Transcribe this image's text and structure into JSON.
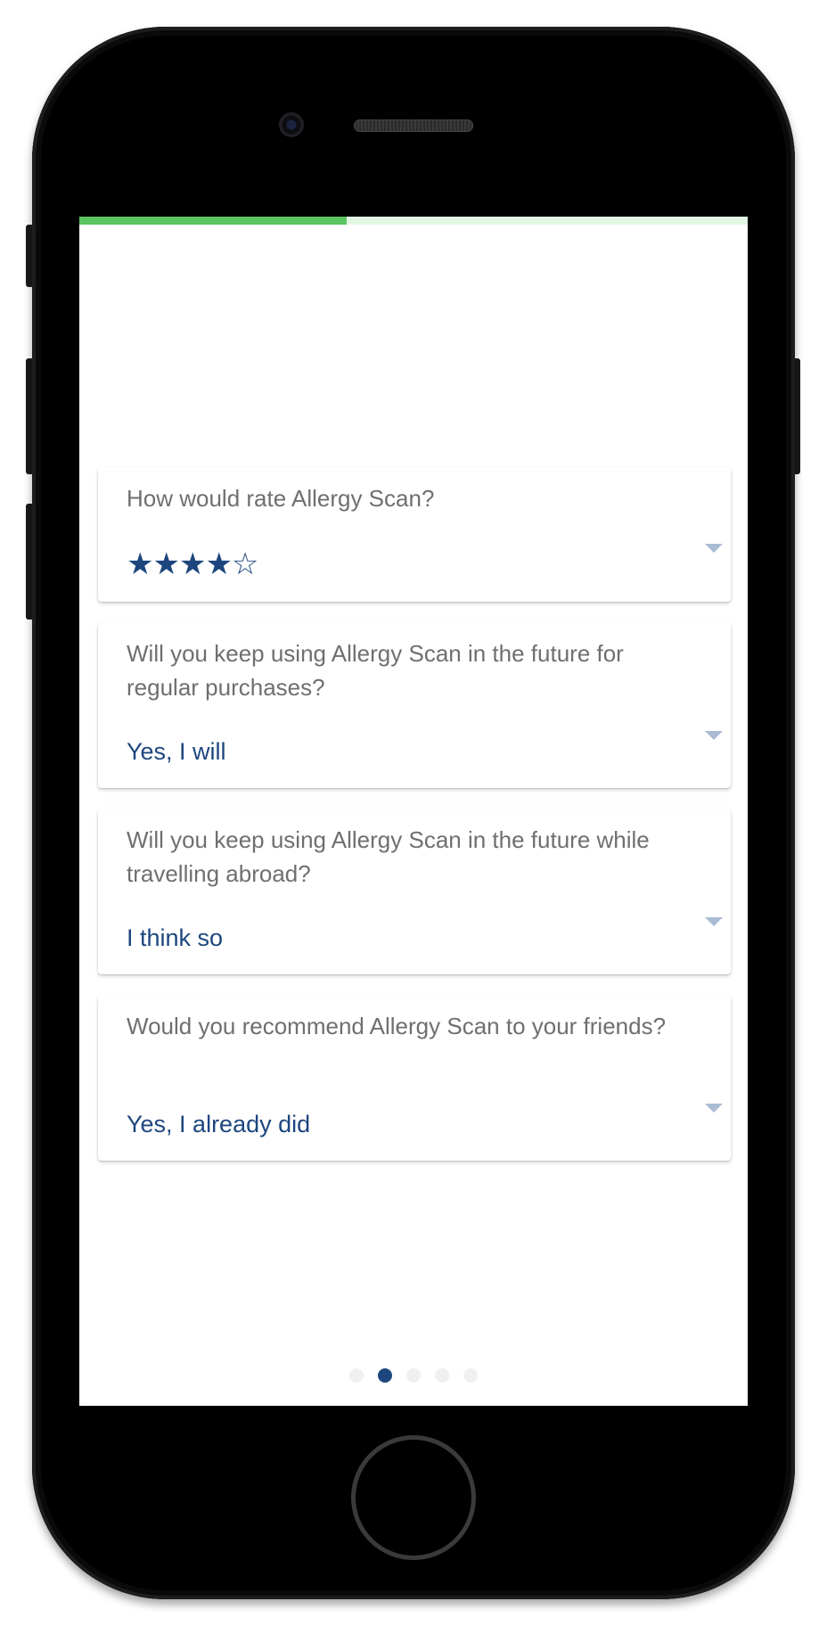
{
  "progress": {
    "fraction": 0.4
  },
  "questions": [
    {
      "question": "How would rate Allergy Scan?",
      "answer_type": "stars",
      "rating": 4,
      "max_rating": 5,
      "stars_text": "★★★★☆"
    },
    {
      "question": "Will you keep using Allergy Scan in the future for regular purchases?",
      "answer": "Yes, I will"
    },
    {
      "question": "Will you keep using Allergy Scan in the future while travelling abroad?",
      "answer": "I think so"
    },
    {
      "question": "Would you recommend Allergy Scan to your friends?",
      "answer": "Yes, I already did"
    }
  ],
  "pagination": {
    "total": 5,
    "current": 2
  },
  "icons": {
    "dropdown": "caret-down-icon",
    "camera": "camera-icon",
    "speaker": "speaker-grille"
  },
  "colors": {
    "accent": "#1d467e",
    "progress": "#5cc462",
    "progress_track": "#e3f6e4",
    "question_text": "#6f6f6f",
    "caret": "#a9bcd3"
  }
}
